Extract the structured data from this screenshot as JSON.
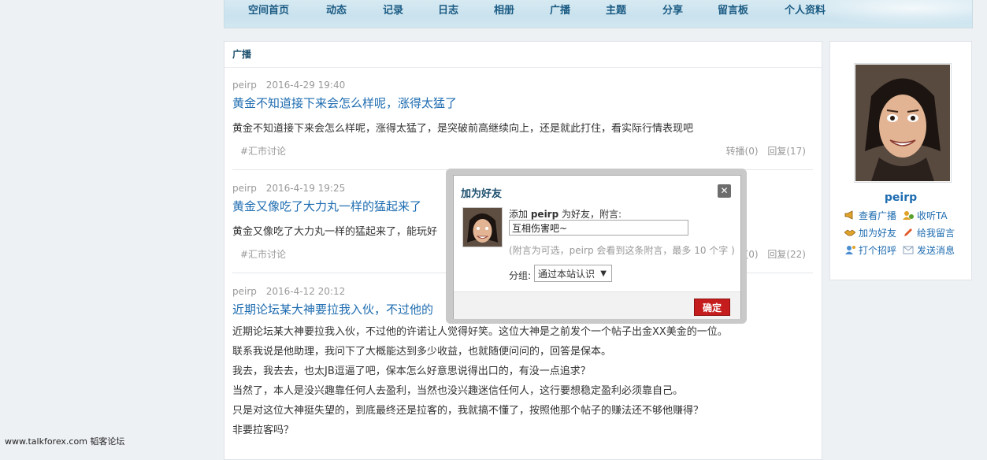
{
  "nav": {
    "items": [
      "空间首页",
      "动态",
      "记录",
      "日志",
      "相册",
      "广播",
      "主题",
      "分享",
      "留言板",
      "个人资料"
    ]
  },
  "feed": {
    "heading": "广播",
    "posts": [
      {
        "author": "peirp",
        "time": "2016-4-29 19:40",
        "title": "黄金不知道接下来会怎么样呢，涨得太猛了",
        "body": "黄金不知道接下来会怎么样呢，涨得太猛了，是突破前高继续向上，还是就此打住，看实际行情表现吧",
        "tag": "#汇市讨论",
        "forward": "转播(0)",
        "reply": "回复(17)"
      },
      {
        "author": "peirp",
        "time": "2016-4-19 19:25",
        "title": "黄金又像吃了大力丸一样的猛起来了",
        "body": "黄金又像吃了大力丸一样的猛起来了，能玩好",
        "tag": "#汇市讨论",
        "forward": "转播(0)",
        "reply": "回复(22)"
      },
      {
        "author": "peirp",
        "time": "2016-4-12 20:12",
        "title": "近期论坛某大神要拉我入伙，不过他的",
        "lines": [
          "近期论坛某大神要拉我入伙，不过他的许诺让人觉得好笑。这位大神是之前发个一个帖子出金XX美金的一位。",
          "联系我说是他助理，我问下了大概能达到多少收益，也就随便问问的，回答是保本。",
          "我去，我去去，也太JB逗逼了吧，保本怎么好意思说得出口的，有没一点追求？",
          "当然了，本人是没兴趣靠任何人去盈利，当然也没兴趣迷信任何人，这行要想稳定盈利必须靠自己。",
          "只是对这位大神挺失望的，到底最终还是拉客的，我就搞不懂了，按照他那个帖子的赚法还不够他赚得？",
          "非要拉客吗？"
        ]
      }
    ]
  },
  "profile": {
    "name": "peirp",
    "links": {
      "view_broadcast": "查看广播",
      "follow": "收听TA",
      "add_friend": "加为好友",
      "leave_message": "给我留言",
      "greet": "打个招呼",
      "send_message": "发送消息"
    }
  },
  "dialog": {
    "title": "加为好友",
    "close": "✕",
    "line_prefix": "添加",
    "line_name": "peirp",
    "line_suffix": "为好友，附言:",
    "note_value": "互相伤害吧~",
    "hint": "(附言为可选，peirp 会看到这条附言，最多 10 个字 )",
    "group_label": "分组:",
    "group_selected": "通过本站认识",
    "confirm": "确定"
  },
  "footer": {
    "watermark": "www.talkforex.com 韬客论坛"
  },
  "colors": {
    "link": "#1e6cb0",
    "confirm": "#c51d1d",
    "nav_text": "#1c5c84"
  }
}
